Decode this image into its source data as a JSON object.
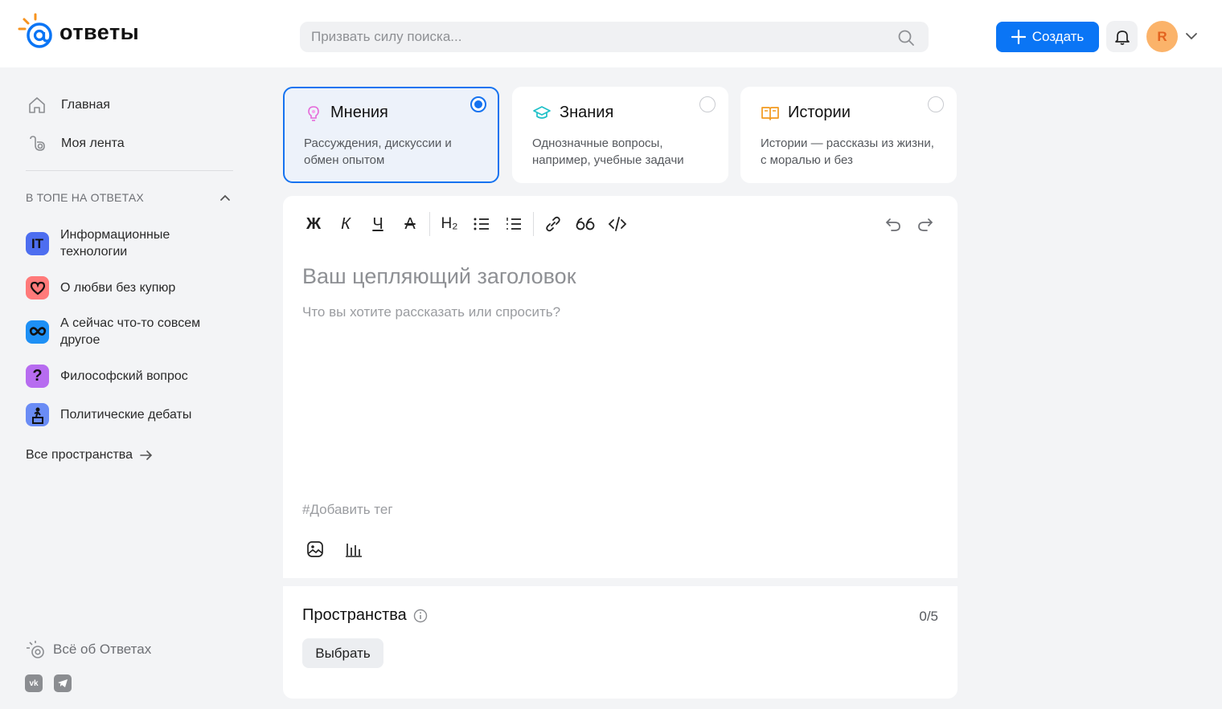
{
  "header": {
    "logo_text": "ответы",
    "search_placeholder": "Призвать силу поиска...",
    "create_label": "Создать",
    "avatar_letter": "R"
  },
  "sidebar": {
    "nav": [
      {
        "label": "Главная",
        "icon": "home-icon"
      },
      {
        "label": "Моя лента",
        "icon": "feed-icon"
      }
    ],
    "section_title": "В ТОПЕ НА ОТВЕТАХ",
    "spaces": [
      {
        "label": "Информационные технологии",
        "icon": "it-icon",
        "badge": "IT",
        "color": "#4d6ef0"
      },
      {
        "label": "О любви без купюр",
        "icon": "heart-icon",
        "color": "#ff7a7a"
      },
      {
        "label": "А сейчас что-то совсем другое",
        "icon": "infinity-icon",
        "color": "#1e90f5"
      },
      {
        "label": "Философский вопрос",
        "icon": "question-icon",
        "badge": "?",
        "color": "#b76cf0"
      },
      {
        "label": "Политические дебаты",
        "icon": "podium-icon",
        "color": "#6a8cf5"
      }
    ],
    "all_spaces": "Все пространства",
    "about": "Всё об Ответах",
    "socials": [
      "vk-icon",
      "telegram-icon"
    ]
  },
  "post_types": [
    {
      "title": "Мнения",
      "desc": "Рассуждения, дискуссии и обмен опытом",
      "icon": "bulb-icon",
      "selected": true
    },
    {
      "title": "Знания",
      "desc": "Однозначные вопросы, например, учебные задачи",
      "icon": "graduation-cap-icon",
      "selected": false
    },
    {
      "title": "Истории",
      "desc": "Истории — рассказы из жизни, с моралью и без",
      "icon": "book-icon",
      "selected": false
    }
  ],
  "editor": {
    "toolbar": {
      "bold": "Ж",
      "italic": "К",
      "underline": "Ч",
      "strike": "А",
      "heading": "H₂"
    },
    "title_placeholder": "Ваш цепляющий заголовок",
    "body_placeholder": "Что вы хотите рассказать или спросить?",
    "tag_placeholder": "#Добавить тег"
  },
  "spaces_block": {
    "title": "Пространства",
    "count": "0/5",
    "choose_label": "Выбрать"
  },
  "colors": {
    "accent": "#0a75f5",
    "selected_card_bg": "#edf2fa",
    "avatar_bg": "#fbb36a"
  }
}
